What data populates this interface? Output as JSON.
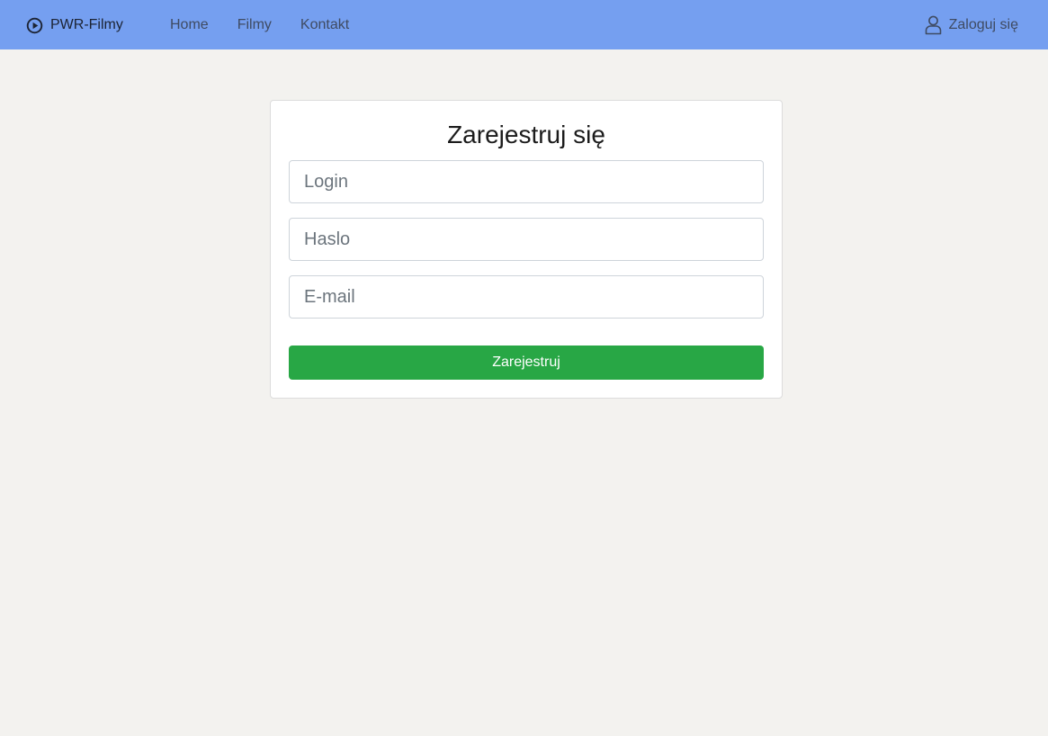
{
  "navbar": {
    "brand": {
      "icon": "play-circle-icon",
      "label": "PWR-Filmy"
    },
    "links": [
      {
        "label": "Home"
      },
      {
        "label": "Filmy"
      },
      {
        "label": "Kontakt"
      }
    ],
    "login": {
      "icon": "user-icon",
      "label": "Zaloguj się"
    },
    "background": "#759ff0"
  },
  "register_form": {
    "title": "Zarejestruj się",
    "login_placeholder": "Login",
    "password_placeholder": "Haslo",
    "email_placeholder": "E-mail",
    "submit_label": "Zarejestruj",
    "submit_color": "#28a745"
  }
}
